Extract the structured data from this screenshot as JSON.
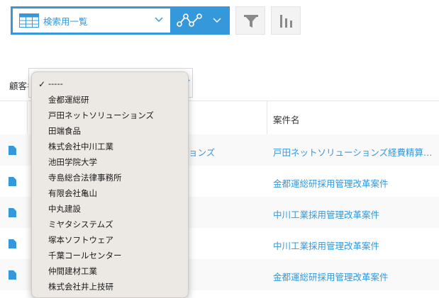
{
  "toolbar": {
    "view_name": "検索用一覧",
    "icons": [
      "table-icon",
      "chevron-down-icon",
      "line-graph-icon",
      "chevron-down-icon",
      "filter-icon",
      "bar-chart-icon"
    ],
    "accent_color": "#3498db"
  },
  "filter": {
    "label": "顧客名"
  },
  "table": {
    "header": "案件名",
    "rows": [
      {
        "col1": "ョンズ",
        "col2": "戸田ネットソリューションズ経費精算…"
      },
      {
        "col1": "",
        "col2": "金都運総研採用管理改革案件"
      },
      {
        "col1": "",
        "col2": "中川工業採用管理改革案件"
      },
      {
        "col1": "",
        "col2": "中川工業採用管理改革案件"
      },
      {
        "col1": "",
        "col2": "金都運総研採用管理改革案件"
      }
    ]
  },
  "dropdown": {
    "selected": "-----",
    "items": [
      "-----",
      "金都運総研",
      "戸田ネットソリューションズ",
      "田端食品",
      "株式会社中川工業",
      "池田学院大学",
      "寺島総合法律事務所",
      "有限会社亀山",
      "中丸建設",
      "ミヤタシステムズ",
      "塚本ソフトウェア",
      "千葉コールセンター",
      "仲間建材工業",
      "株式会社井上技研"
    ]
  }
}
